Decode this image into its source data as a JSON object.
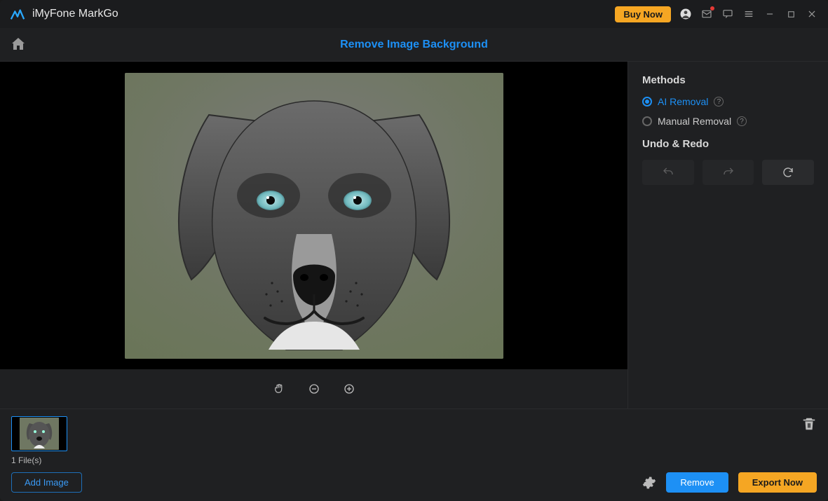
{
  "titlebar": {
    "app_name": "iMyFone MarkGo",
    "buy_label": "Buy Now"
  },
  "header": {
    "page_title": "Remove Image Background"
  },
  "sidebar": {
    "methods_title": "Methods",
    "options": [
      {
        "label": "AI Removal",
        "selected": true
      },
      {
        "label": "Manual Removal",
        "selected": false
      }
    ],
    "undo_title": "Undo & Redo"
  },
  "footer": {
    "file_count": "1 File(s)",
    "add_label": "Add Image",
    "remove_label": "Remove",
    "export_label": "Export Now"
  }
}
